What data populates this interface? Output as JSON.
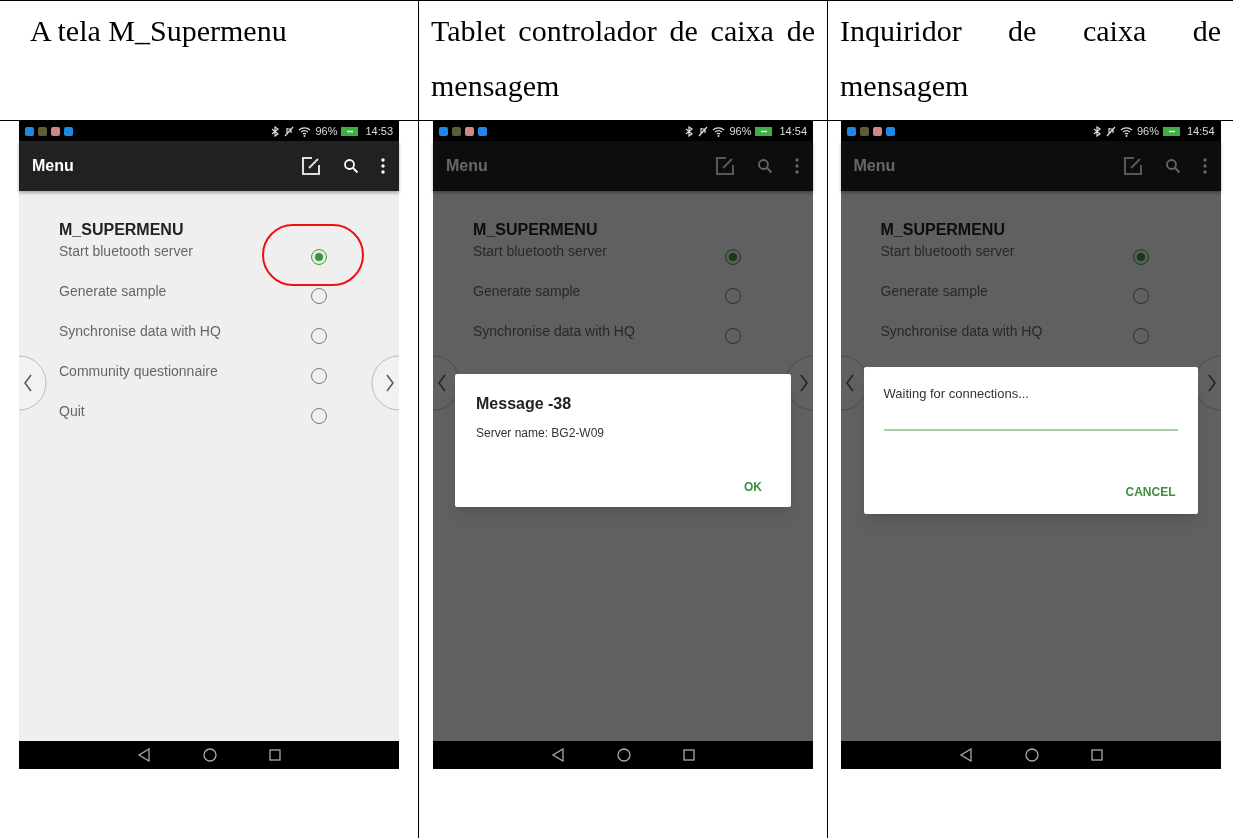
{
  "columns": [
    {
      "header": "A tela M_Supermenu",
      "screen": {
        "status_bar": {
          "battery": "96%",
          "time": "14:53"
        },
        "app_bar_title": "Menu",
        "menu_title": "M_SUPERMENU",
        "items": [
          {
            "label": "Start bluetooth server",
            "selected": true,
            "circled": true
          },
          {
            "label": "Generate sample",
            "selected": false,
            "circled": false
          },
          {
            "label": "Synchronise data with HQ",
            "selected": false,
            "circled": false
          },
          {
            "label": "Community questionnaire",
            "selected": false,
            "circled": false
          },
          {
            "label": "Quit",
            "selected": false,
            "circled": false
          }
        ]
      }
    },
    {
      "header": "Tablet controlador de caixa de mensagem",
      "screen": {
        "status_bar": {
          "battery": "96%",
          "time": "14:54"
        },
        "app_bar_title": "Menu",
        "menu_title": "M_SUPERMENU",
        "items": [
          {
            "label": "Start bluetooth server",
            "selected": true,
            "circled": false
          },
          {
            "label": "Generate sample",
            "selected": false,
            "circled": false
          },
          {
            "label": "Synchronise data with HQ",
            "selected": false,
            "circled": false
          }
        ],
        "dialog": {
          "kind": "message",
          "title": "Message -38",
          "body": "Server name: BG2-W09",
          "button": "OK"
        }
      }
    },
    {
      "header": "Inquiridor de caixa de mensagem",
      "screen": {
        "status_bar": {
          "battery": "96%",
          "time": "14:54"
        },
        "app_bar_title": "Menu",
        "menu_title": "M_SUPERMENU",
        "items": [
          {
            "label": "Start bluetooth server",
            "selected": true,
            "circled": false
          },
          {
            "label": "Generate sample",
            "selected": false,
            "circled": false
          },
          {
            "label": "Synchronise data with HQ",
            "selected": false,
            "circled": false
          }
        ],
        "dialog": {
          "kind": "progress",
          "body": "Waiting for connections...",
          "level": 1,
          "button": "CANCEL"
        }
      }
    }
  ]
}
